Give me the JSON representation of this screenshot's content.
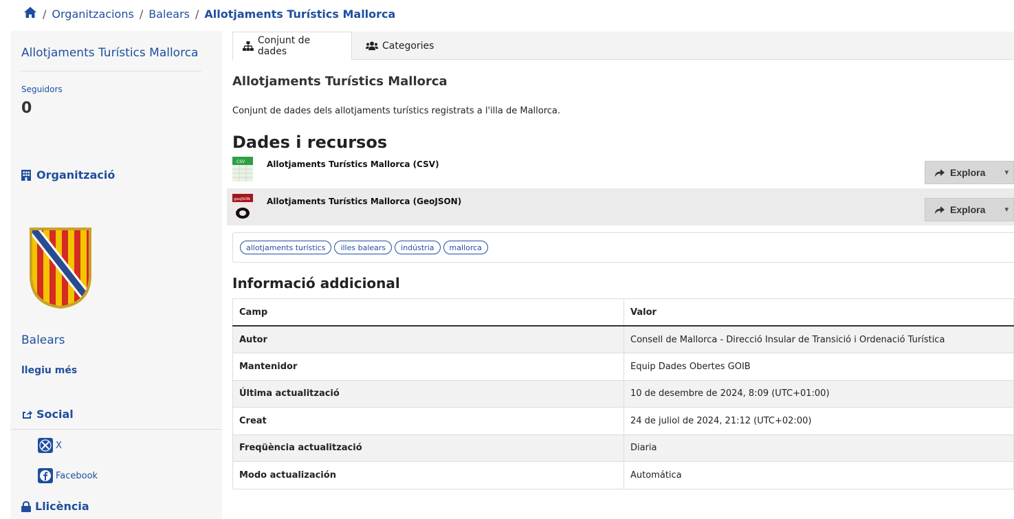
{
  "breadcrumb": {
    "items": [
      "Organitzacions",
      "Balears"
    ],
    "current": "Allotjaments Turístics Mallorca",
    "separator": "/"
  },
  "sidebar": {
    "title": "Allotjaments Turístics Mallorca",
    "followers_label": "Seguidors",
    "followers_count": "0",
    "organization_heading": "Organització",
    "organization_name": "Balears",
    "read_more": "llegiu més",
    "social_heading": "Social",
    "social_items": [
      {
        "label": "X",
        "icon": "x-icon"
      },
      {
        "label": "Facebook",
        "icon": "facebook-icon"
      }
    ],
    "license_heading": "Llicència"
  },
  "tabs": [
    {
      "label": "Conjunt de dades",
      "icon": "sitemap-icon",
      "active": true
    },
    {
      "label": "Categories",
      "icon": "users-icon",
      "active": false
    }
  ],
  "dataset": {
    "title": "Allotjaments Turístics Mallorca",
    "description": "Conjunt de dades dels allotjaments turístics registrats a l'illa de Mallorca."
  },
  "resources": {
    "heading": "Dades i recursos",
    "items": [
      {
        "title": "Allotjaments Turístics Mallorca (CSV)",
        "format": "CSV",
        "button": "Explora"
      },
      {
        "title": "Allotjaments Turístics Mallorca (GeoJSON)",
        "format": "geoJSON",
        "button": "Explora"
      }
    ]
  },
  "tags": [
    "allotjaments turístics",
    "illes balears",
    "indústria",
    "mallorca"
  ],
  "additional_info": {
    "heading": "Informació addicional",
    "columns": [
      "Camp",
      "Valor"
    ],
    "rows": [
      {
        "key": "Autor",
        "value": "Consell de Mallorca - Direcció Insular de Transició i Ordenació Turística"
      },
      {
        "key": "Mantenidor",
        "value": "Equip Dades Obertes GOIB"
      },
      {
        "key": "Última actualització",
        "value": "10 de desembre de 2024, 8:09 (UTC+01:00)"
      },
      {
        "key": "Creat",
        "value": "24 de juliol de 2024, 21:12 (UTC+02:00)"
      },
      {
        "key": "Freqüència actualització",
        "value": "Diaria"
      },
      {
        "key": "Modo actualización",
        "value": "Automática"
      }
    ]
  },
  "colors": {
    "link": "#1f4e9e",
    "sidebar_bg": "#f6f6f6",
    "button_bg": "#d7d7d7"
  }
}
